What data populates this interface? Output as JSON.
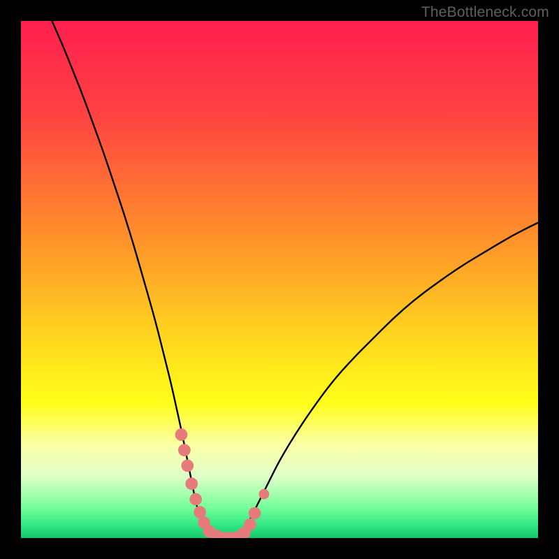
{
  "watermark": {
    "text": "TheBottleneck.com"
  },
  "chart_data": {
    "type": "line",
    "title": "",
    "xlabel": "",
    "ylabel": "",
    "xlim": [
      0,
      100
    ],
    "ylim": [
      0,
      100
    ],
    "grid": false,
    "legend": false,
    "background_gradient_stops": [
      {
        "offset": 0.0,
        "color": "#ff1f4f"
      },
      {
        "offset": 0.18,
        "color": "#ff4242"
      },
      {
        "offset": 0.4,
        "color": "#ff8a2b"
      },
      {
        "offset": 0.6,
        "color": "#ffd21f"
      },
      {
        "offset": 0.74,
        "color": "#ffff1a"
      },
      {
        "offset": 0.82,
        "color": "#fbffa7"
      },
      {
        "offset": 0.88,
        "color": "#e0ffc8"
      },
      {
        "offset": 0.94,
        "color": "#77ff9a"
      },
      {
        "offset": 0.975,
        "color": "#30e884"
      },
      {
        "offset": 1.0,
        "color": "#17c768"
      }
    ],
    "series": [
      {
        "name": "bottleneck-curve",
        "color": "#000000",
        "x": [
          6,
          8,
          10,
          12,
          14,
          16,
          18,
          20,
          22,
          24,
          26,
          28,
          29,
          30,
          31,
          32,
          33,
          34,
          35,
          36,
          37,
          38,
          39,
          40,
          41,
          42,
          43,
          44,
          46,
          48,
          50,
          53,
          56,
          60,
          64,
          68,
          72,
          76,
          80,
          85,
          90,
          95,
          100
        ],
        "y": [
          100,
          95.5,
          90.5,
          85.5,
          80,
          74.5,
          68.5,
          62.5,
          56,
          49,
          42,
          34,
          30,
          25.5,
          21,
          16,
          11,
          6,
          3,
          1.2,
          0.4,
          0,
          0,
          0,
          0,
          0.4,
          1.2,
          3,
          7,
          11,
          15,
          20,
          24.5,
          30,
          34.5,
          38.5,
          42.5,
          46,
          49,
          52.5,
          55.5,
          58.5,
          61
        ]
      }
    ],
    "markers": [
      {
        "name": "left-cluster-1",
        "x": 31.0,
        "y": 20.0,
        "r": 1.2,
        "color": "#e77b7b"
      },
      {
        "name": "left-cluster-2",
        "x": 31.6,
        "y": 17.0,
        "r": 1.2,
        "color": "#e77b7b"
      },
      {
        "name": "left-cluster-3",
        "x": 32.2,
        "y": 14.0,
        "r": 1.2,
        "color": "#e77b7b"
      },
      {
        "name": "left-cluster-4",
        "x": 33.0,
        "y": 10.5,
        "r": 1.2,
        "color": "#e77b7b"
      },
      {
        "name": "left-cluster-5",
        "x": 33.8,
        "y": 7.5,
        "r": 1.2,
        "color": "#e77b7b"
      },
      {
        "name": "left-cluster-6",
        "x": 34.6,
        "y": 5.0,
        "r": 1.2,
        "color": "#e77b7b"
      },
      {
        "name": "left-cluster-7",
        "x": 35.4,
        "y": 3.0,
        "r": 1.2,
        "color": "#e77b7b"
      },
      {
        "name": "bottom-1",
        "x": 36.4,
        "y": 1.3,
        "r": 1.2,
        "color": "#e77b7b"
      },
      {
        "name": "bottom-2",
        "x": 37.8,
        "y": 0.4,
        "r": 1.2,
        "color": "#e77b7b"
      },
      {
        "name": "bottom-3",
        "x": 39.2,
        "y": 0.0,
        "r": 1.2,
        "color": "#e77b7b"
      },
      {
        "name": "bottom-4",
        "x": 40.6,
        "y": 0.0,
        "r": 1.2,
        "color": "#e77b7b"
      },
      {
        "name": "bottom-5",
        "x": 42.0,
        "y": 0.2,
        "r": 1.2,
        "color": "#e77b7b"
      },
      {
        "name": "bottom-6",
        "x": 43.2,
        "y": 1.0,
        "r": 1.2,
        "color": "#e77b7b"
      },
      {
        "name": "right-cluster-1",
        "x": 44.3,
        "y": 2.6,
        "r": 1.2,
        "color": "#e77b7b"
      },
      {
        "name": "right-cluster-2",
        "x": 45.2,
        "y": 4.8,
        "r": 1.2,
        "color": "#e77b7b"
      },
      {
        "name": "right-outlier",
        "x": 47.0,
        "y": 8.5,
        "r": 1.0,
        "color": "#e77b7b"
      }
    ]
  }
}
